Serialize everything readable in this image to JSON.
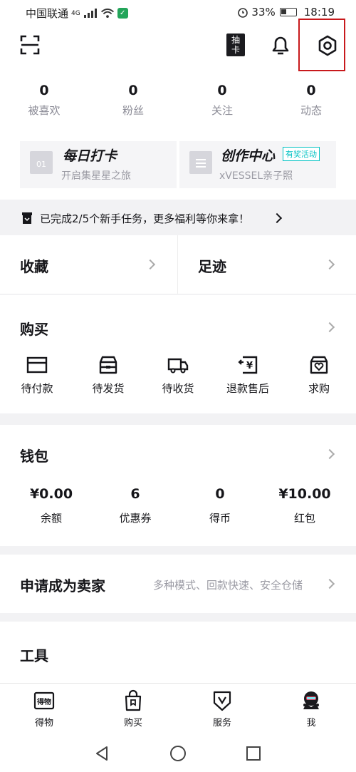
{
  "status_bar": {
    "carrier": "中国联通",
    "network": "4G",
    "battery_pct": "33%",
    "time": "18:19"
  },
  "header": {
    "icons": [
      "scan-icon",
      "draw-card-icon",
      "bell-icon",
      "settings-icon"
    ],
    "draw_card_label": "抽卡"
  },
  "stats": [
    {
      "value": "0",
      "label": "被喜欢"
    },
    {
      "value": "0",
      "label": "粉丝"
    },
    {
      "value": "0",
      "label": "关注"
    },
    {
      "value": "0",
      "label": "动态"
    }
  ],
  "cards": {
    "checkin": {
      "title": "每日打卡",
      "subtitle": "开启集星星之旅",
      "icon_text": "01"
    },
    "creator": {
      "title": "创作中心",
      "badge": "有奖活动",
      "subtitle": "xVESSEL亲子照"
    }
  },
  "task_bar": {
    "text": "已完成2/5个新手任务，更多福利等你来拿！"
  },
  "favorites": {
    "left": "收藏",
    "right": "足迹"
  },
  "purchase": {
    "title": "购买",
    "items": [
      {
        "label": "待付款",
        "icon": "card-icon"
      },
      {
        "label": "待发货",
        "icon": "box-icon"
      },
      {
        "label": "待收货",
        "icon": "truck-icon"
      },
      {
        "label": "退款售后",
        "icon": "refund-icon"
      },
      {
        "label": "求购",
        "icon": "bag-heart-icon"
      }
    ]
  },
  "wallet": {
    "title": "钱包",
    "items": [
      {
        "value": "¥0.00",
        "label": "余额"
      },
      {
        "value": "6",
        "label": "优惠券"
      },
      {
        "value": "0",
        "label": "得币"
      },
      {
        "value": "¥10.00",
        "label": "红包"
      }
    ]
  },
  "seller": {
    "title": "申请成为卖家",
    "subtitle": "多种模式、回款快速、安全仓储"
  },
  "tools": {
    "title": "工具"
  },
  "bottom_nav": [
    {
      "label": "得物",
      "icon": "dewu-logo-icon"
    },
    {
      "label": "购买",
      "icon": "shopping-bag-icon"
    },
    {
      "label": "服务",
      "icon": "service-shield-icon"
    },
    {
      "label": "我",
      "icon": "avatar-icon"
    }
  ],
  "colors": {
    "accent": "#01c2c3",
    "highlight_box": "#c8191c",
    "text": "#16161a",
    "muted": "#8b8b96"
  }
}
